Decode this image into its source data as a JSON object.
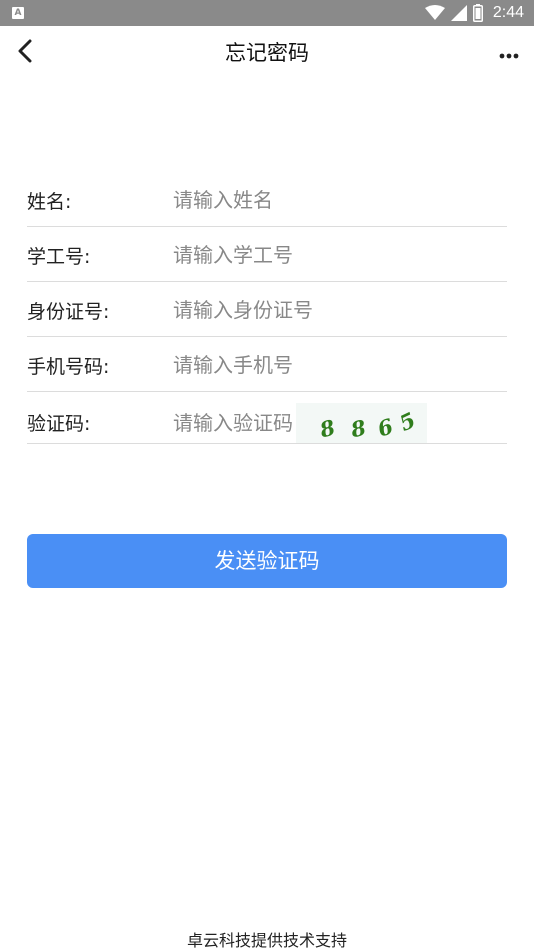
{
  "status_bar": {
    "time": "2:44",
    "left_icon": "A",
    "icons": [
      "wifi-icon",
      "signal-icon",
      "battery-icon"
    ]
  },
  "app_bar": {
    "title": "忘记密码",
    "back_icon": "chevron-left-icon",
    "more_icon": "more-horizontal-icon"
  },
  "form": {
    "name": {
      "label": "姓名:",
      "placeholder": "请输入姓名",
      "value": ""
    },
    "student_id": {
      "label": "学工号:",
      "placeholder": "请输入学工号",
      "value": ""
    },
    "id_card": {
      "label": "身份证号:",
      "placeholder": "请输入身份证号",
      "value": ""
    },
    "phone": {
      "label": "手机号码:",
      "placeholder": "请输入手机号",
      "value": ""
    },
    "captcha": {
      "label": "验证码:",
      "placeholder": "请输入验证码",
      "value": "",
      "image_text": "8865"
    }
  },
  "submit": {
    "label": "发送验证码"
  },
  "footer": {
    "text": "卓云科技提供技术支持"
  },
  "colors": {
    "status_bar": "#8a8a8a",
    "primary_button": "#4a8ff5",
    "captcha_text": "#2f7d1c",
    "divider": "#dcdcdc"
  }
}
